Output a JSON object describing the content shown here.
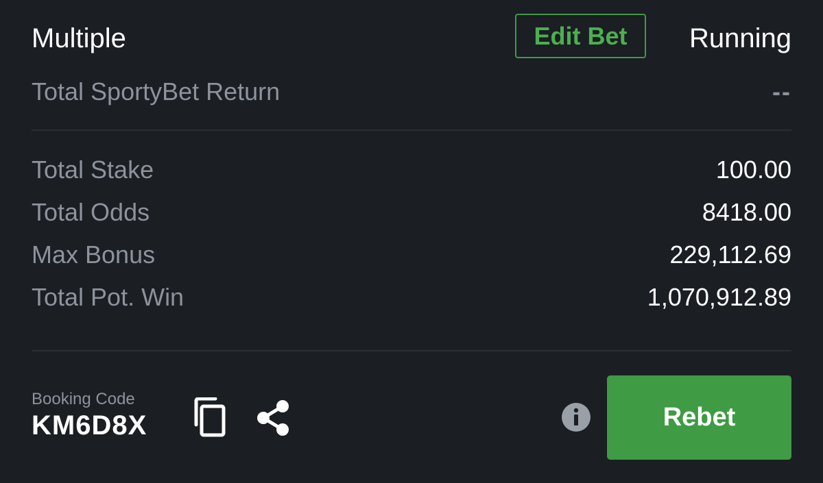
{
  "header": {
    "bet_type": "Multiple",
    "edit_bet_label": "Edit Bet",
    "status": "Running"
  },
  "return": {
    "label": "Total SportyBet Return",
    "value": "--"
  },
  "summary": [
    {
      "label": "Total Stake",
      "value": "100.00"
    },
    {
      "label": "Total Odds",
      "value": "8418.00"
    },
    {
      "label": "Max Bonus",
      "value": "229,112.69"
    },
    {
      "label": "Total Pot. Win",
      "value": "1,070,912.89"
    }
  ],
  "booking": {
    "label": "Booking Code",
    "code": "KM6D8X"
  },
  "actions": {
    "copy_icon": "copy-icon",
    "share_icon": "share-icon",
    "info_icon": "info-icon",
    "rebet_label": "Rebet"
  },
  "colors": {
    "background": "#1b1e23",
    "accent_green": "#3f9b44",
    "muted_text": "#8d939c"
  }
}
